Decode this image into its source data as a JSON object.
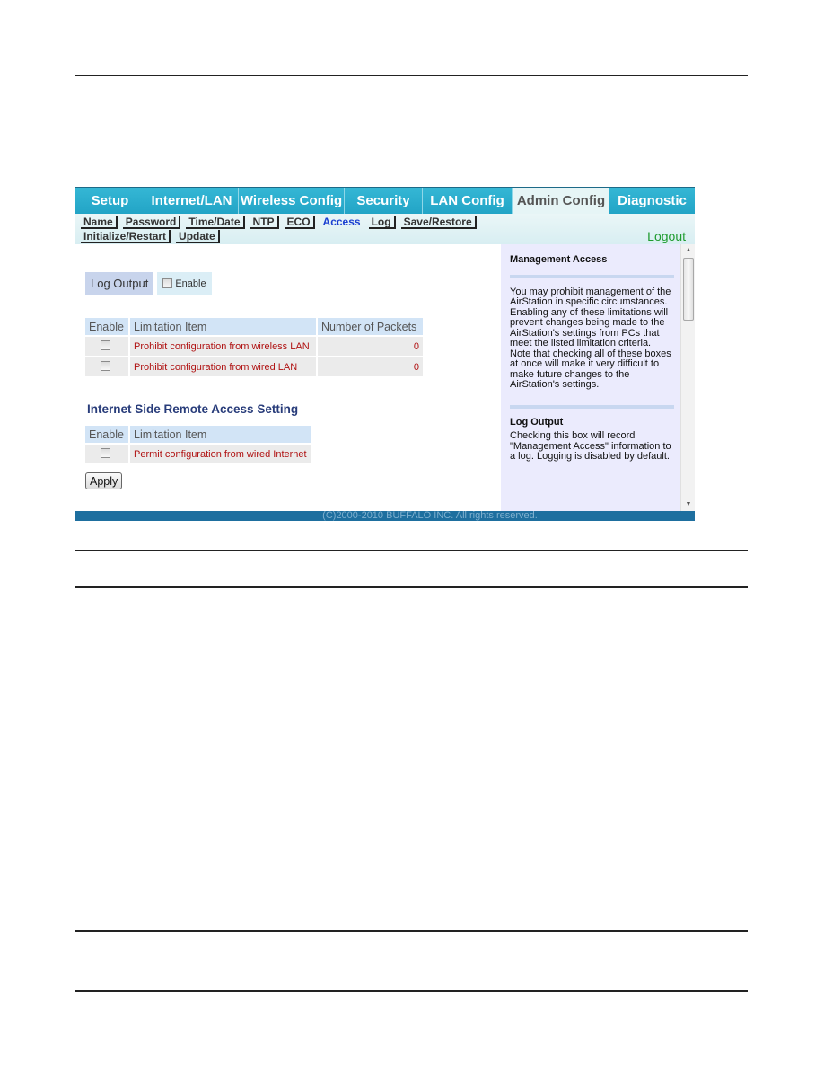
{
  "tabs": [
    {
      "label": "Setup",
      "active": false
    },
    {
      "label": "Internet/LAN",
      "active": false
    },
    {
      "label": "Wireless Config",
      "active": false
    },
    {
      "label": "Security",
      "active": false
    },
    {
      "label": "LAN Config",
      "active": false
    },
    {
      "label": "Admin Config",
      "active": true
    },
    {
      "label": "Diagnostic",
      "active": false
    }
  ],
  "subnav": {
    "row1": [
      "Name",
      "Password",
      "Time/Date",
      "NTP",
      "ECO",
      "Access",
      "Log",
      "Save/Restore"
    ],
    "row2": [
      "Initialize/Restart",
      "Update"
    ],
    "active": "Access",
    "logout": "Logout"
  },
  "log_output": {
    "label": "Log Output",
    "enable_label": "Enable",
    "checked": false
  },
  "management_table": {
    "headers": [
      "Enable",
      "Limitation Item",
      "Number of Packets"
    ],
    "rows": [
      {
        "checked": false,
        "item": "Prohibit configuration from wireless LAN",
        "packets": "0"
      },
      {
        "checked": false,
        "item": "Prohibit configuration from wired LAN",
        "packets": "0"
      }
    ]
  },
  "internet_section": {
    "title": "Internet Side Remote Access Setting",
    "headers": [
      "Enable",
      "Limitation Item"
    ],
    "rows": [
      {
        "checked": false,
        "item": "Permit configuration from wired Internet"
      }
    ]
  },
  "apply_label": "Apply",
  "help": {
    "sections": [
      {
        "title": "Management Access",
        "text": "You may prohibit management of the AirStation in specific circumstances. Enabling any of these limitations will prevent changes being made to the AirStation's settings from PCs that meet the listed limitation criteria. Note that checking all of these boxes at once will make it very difficult to make future changes to the AirStation's settings."
      },
      {
        "title": "Log Output",
        "text": "Checking this box will record \"Management Access\" information to a log. Logging is disabled by default."
      }
    ]
  },
  "footer": "(C)2000-2010 BUFFALO INC. All rights reserved.",
  "colors": {
    "tab_bar": "#22a4c6",
    "active_subnav": "#1a3fd1",
    "logout": "#1f9b2f",
    "item_text": "#b01212",
    "section_title": "#283c7a",
    "footer_bar": "#1e6f9f",
    "help_bg": "#ebebfd"
  }
}
